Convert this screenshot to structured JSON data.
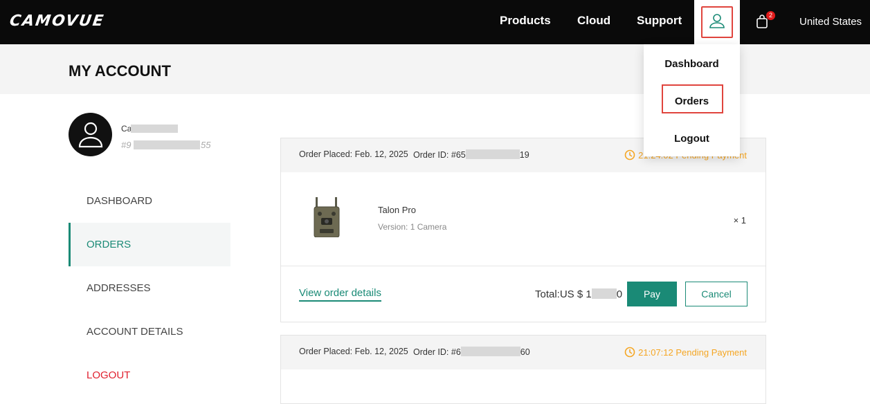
{
  "header": {
    "logo": "CAMOVUE",
    "nav": [
      "Products",
      "Cloud",
      "Support"
    ],
    "cart_count": "2",
    "region": "United States"
  },
  "account_menu": {
    "items": [
      "Dashboard",
      "Orders",
      "Logout"
    ]
  },
  "page": {
    "title": "MY ACCOUNT"
  },
  "user": {
    "name": "Ca",
    "id": "#9",
    "id_suffix": "55"
  },
  "sidebar": {
    "items": [
      "DASHBOARD",
      "ORDERS",
      "ADDRESSES",
      "ACCOUNT DETAILS",
      "LOGOUT"
    ],
    "active": "ORDERS"
  },
  "orders": [
    {
      "placed_label": "Order Placed:",
      "placed_date": "Feb. 12, 2025",
      "id_label": "Order ID:",
      "id_prefix": "#65",
      "id_suffix": "19",
      "timer": "21:24:02",
      "status": "Pending Payment",
      "product": {
        "name": "Talon Pro",
        "version": "Version: 1 Camera",
        "quantity": "× 1"
      },
      "view_details": "View order details",
      "total_label": "Total:US $ 1",
      "total_suffix": "0",
      "pay": "Pay",
      "cancel": "Cancel"
    },
    {
      "placed_label": "Order Placed:",
      "placed_date": "Feb. 12, 2025",
      "id_label": "Order ID:",
      "id_prefix": "#6",
      "id_suffix": "60",
      "timer": "21:07:12",
      "status": "Pending Payment"
    }
  ],
  "colors": {
    "accent": "#1a8a76",
    "warning": "#f5a623",
    "danger": "#e0202e",
    "highlight": "#e0443d"
  }
}
